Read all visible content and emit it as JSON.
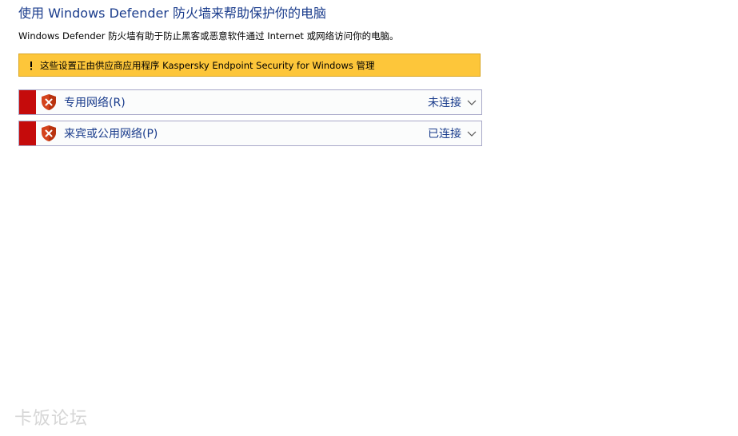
{
  "header": {
    "title": "使用 Windows Defender 防火墙来帮助保护你的电脑",
    "description": "Windows Defender 防火墙有助于防止黑客或恶意软件通过 Internet 或网络访问你的电脑。"
  },
  "banner": {
    "icon": "warning-icon",
    "text": "这些设置正由供应商应用程序 Kaspersky Endpoint Security for Windows 管理",
    "color": "#fdc63a"
  },
  "networks": [
    {
      "name": "专用网络(R)",
      "status": "未连接",
      "icon": "shield-error-icon",
      "status_color": "#c50b0b"
    },
    {
      "name": "来宾或公用网络(P)",
      "status": "已连接",
      "icon": "shield-error-icon",
      "status_color": "#c50b0b"
    }
  ],
  "watermark": {
    "text": "卡饭论坛"
  }
}
